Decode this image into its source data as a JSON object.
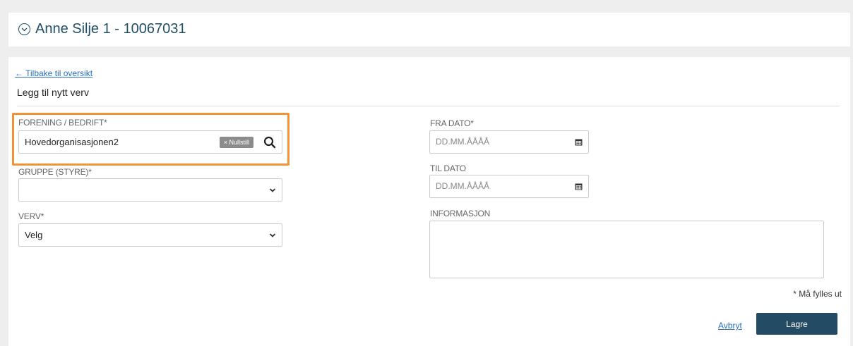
{
  "header": {
    "title": "Anne Silje 1 - 10067031",
    "collapse_icon": "chevron-down-circle-icon"
  },
  "form": {
    "back_link": "← Tilbake til oversikt",
    "title": "Legg til nytt verv",
    "forening": {
      "label": "FORENING / BEDRIFT*",
      "value": "Hovedorganisasjonen2",
      "clear_label": "× Nullstill",
      "search_icon": "search-icon"
    },
    "gruppe": {
      "label": "GRUPPE (STYRE)*",
      "value": ""
    },
    "verv": {
      "label": "VERV*",
      "value": "Velg"
    },
    "fra_dato": {
      "label": "FRA DATO*",
      "placeholder": "DD.MM.ÅÅÅÅ"
    },
    "til_dato": {
      "label": "TIL DATO",
      "placeholder": "DD.MM.ÅÅÅÅ"
    },
    "informasjon": {
      "label": "INFORMASJON",
      "value": ""
    },
    "required_note": "* Må fylles ut",
    "cancel_label": "Avbryt",
    "save_label": "Lagre"
  },
  "colors": {
    "highlight": "#f39237",
    "primary": "#234b63",
    "link": "#2a6ebb",
    "title": "#1f4e66"
  }
}
